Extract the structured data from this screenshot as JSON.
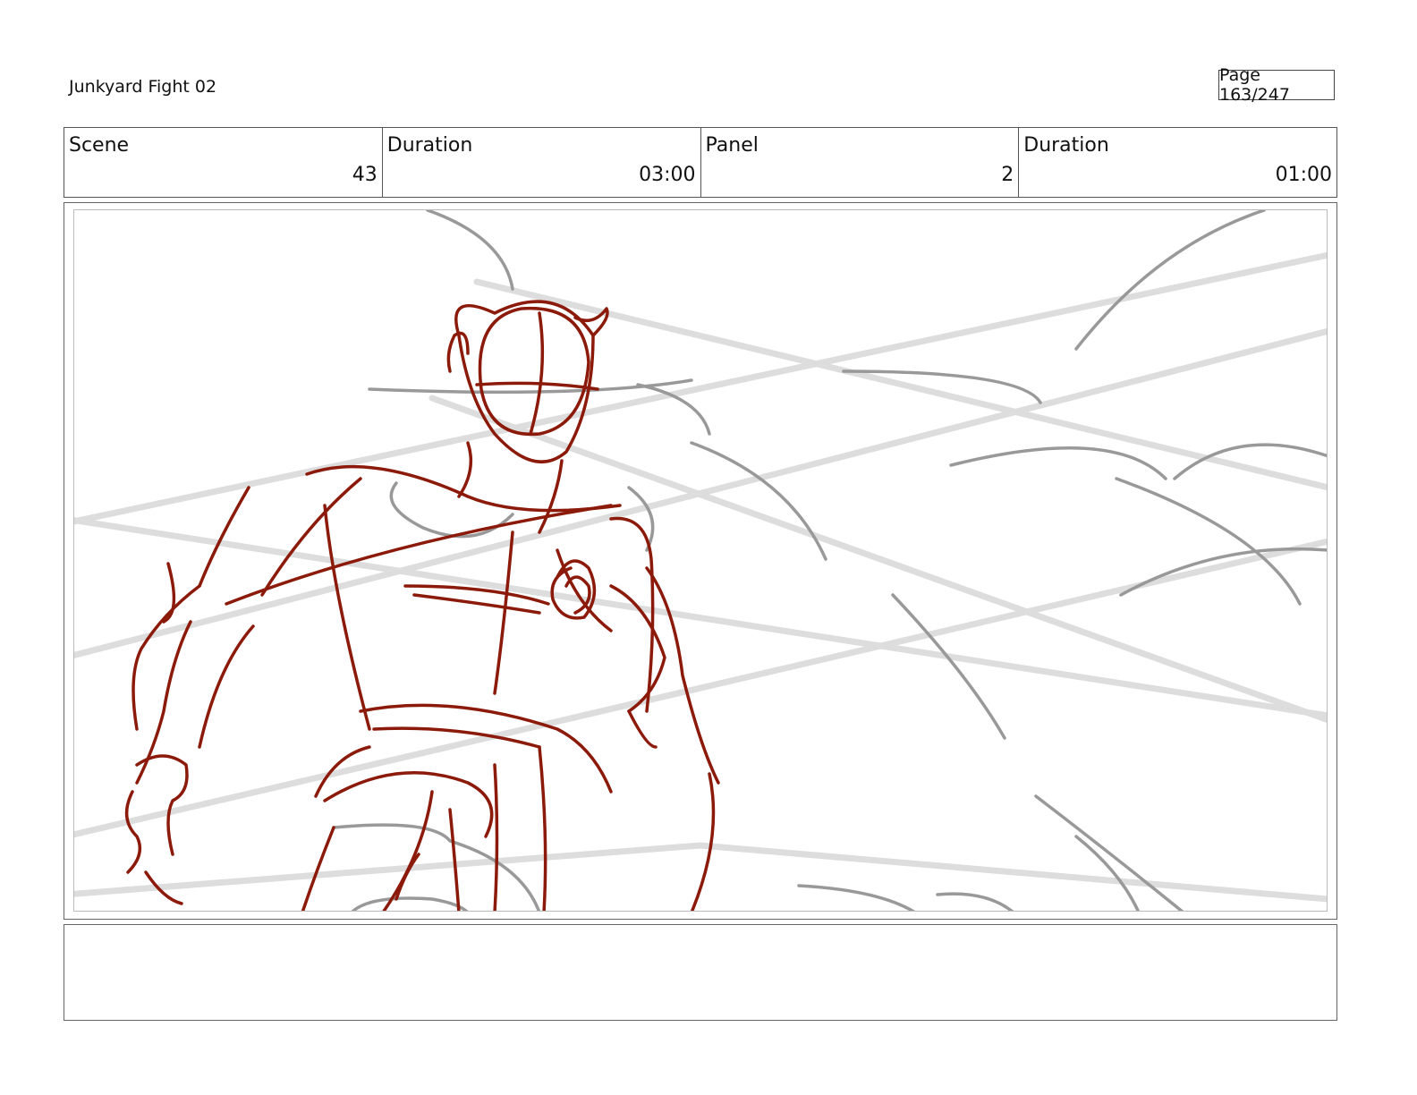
{
  "header": {
    "title": "Junkyard Fight 02",
    "page": "Page 163/247"
  },
  "info": {
    "scene_label": "Scene",
    "scene_value": "43",
    "scene_duration_label": "Duration",
    "scene_duration_value": "03:00",
    "panel_label": "Panel",
    "panel_value": "2",
    "panel_duration_label": "Duration",
    "panel_duration_value": "01:00"
  },
  "sketch": {
    "figure_color": "#8b1a0a",
    "background_color": "#999999",
    "speed_line_color": "#dddddd"
  },
  "notes": {
    "text": ""
  }
}
